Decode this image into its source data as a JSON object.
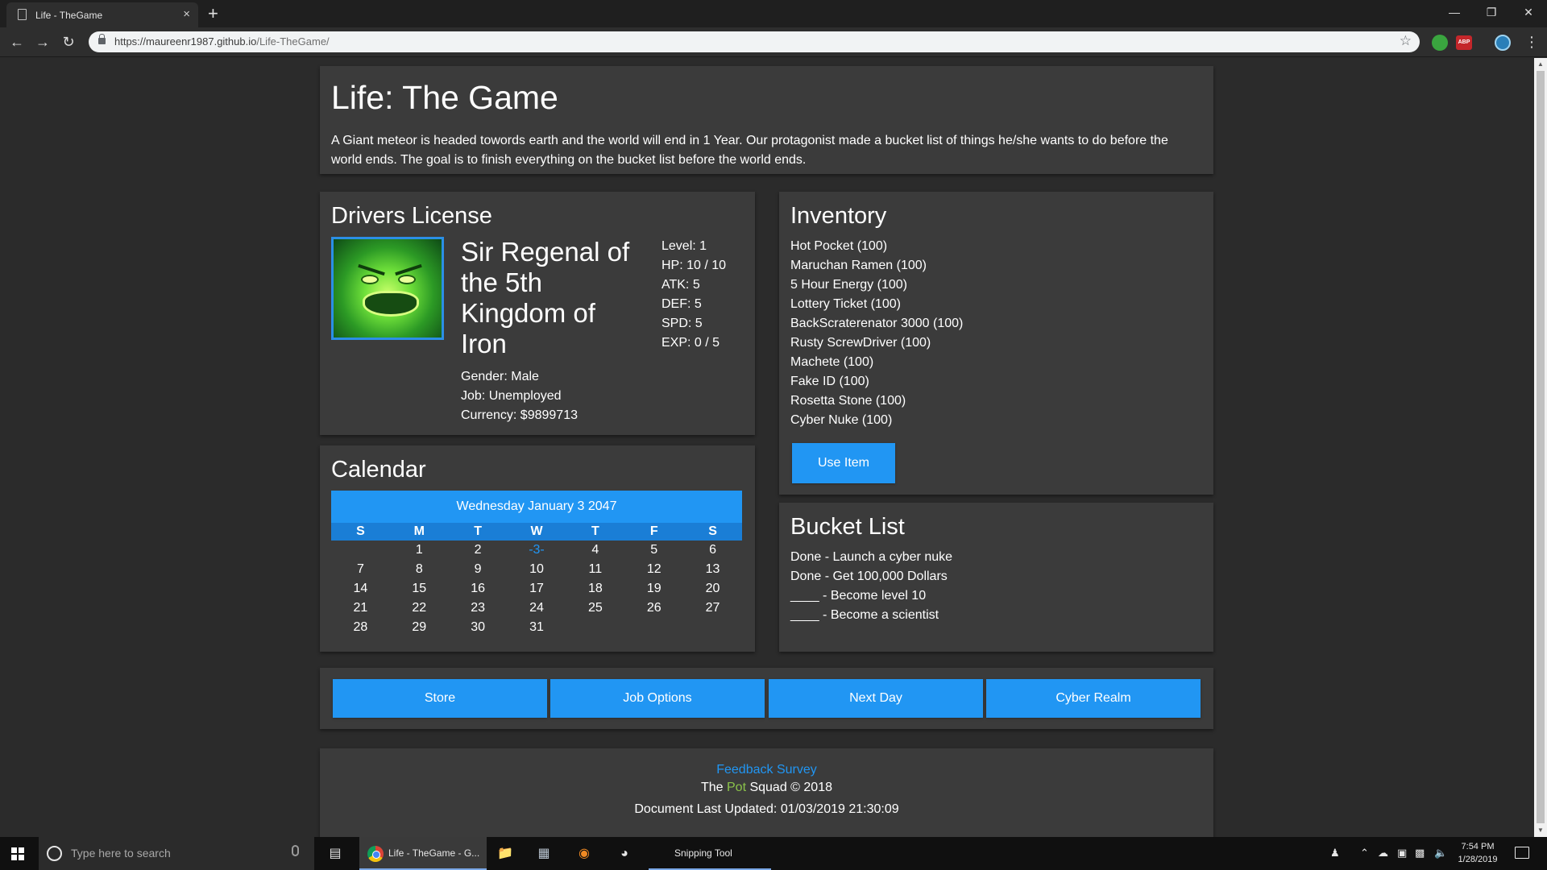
{
  "browser": {
    "tab_title": "Life - TheGame",
    "tab_close": "×",
    "new_tab": "+",
    "url_host": "https://maureenr1987.github.io",
    "url_path": "/Life-TheGame/",
    "abp_label": "ABP",
    "window_minimize": "—",
    "window_restore": "❐",
    "window_close": "✕"
  },
  "header": {
    "title": "Life: The Game",
    "description": "A Giant meteor is headed towords earth and the world will end in 1 Year. Our protagonist made a bucket list of things he/she wants to do before the world ends. The goal is to finish everything on the bucket list before the world ends."
  },
  "license": {
    "heading": "Drivers License",
    "name": "Sir Regenal of the 5th Kingdom of Iron",
    "gender": "Gender: Male",
    "job": "Job: Unemployed",
    "currency": "Currency: $9899713",
    "stats": {
      "level": "Level: 1",
      "hp": "HP: 10 / 10",
      "atk": "ATK: 5",
      "def": "DEF: 5",
      "spd": "SPD: 5",
      "exp": "EXP: 0 / 5"
    }
  },
  "calendar": {
    "heading": "Calendar",
    "date_header": "Wednesday January 3 2047",
    "weekdays": [
      "S",
      "M",
      "T",
      "W",
      "T",
      "F",
      "S"
    ],
    "weeks": [
      [
        "",
        "1",
        "2",
        "-3-",
        "4",
        "5",
        "6"
      ],
      [
        "7",
        "8",
        "9",
        "10",
        "11",
        "12",
        "13"
      ],
      [
        "14",
        "15",
        "16",
        "17",
        "18",
        "19",
        "20"
      ],
      [
        "21",
        "22",
        "23",
        "24",
        "25",
        "26",
        "27"
      ],
      [
        "28",
        "29",
        "30",
        "31",
        "",
        "",
        ""
      ]
    ]
  },
  "inventory": {
    "heading": "Inventory",
    "items": [
      "Hot Pocket (100)",
      "Maruchan Ramen (100)",
      "5 Hour Energy (100)",
      "Lottery Ticket (100)",
      "BackScraterenator 3000 (100)",
      "Rusty ScrewDriver (100)",
      "Machete (100)",
      "Fake ID (100)",
      "Rosetta Stone (100)",
      "Cyber Nuke (100)"
    ],
    "use_button": "Use Item"
  },
  "bucket_list": {
    "heading": "Bucket List",
    "items": [
      "Done - Launch a cyber nuke",
      "Done - Get 100,000 Dollars",
      "____ - Become level 10",
      "____ - Become a scientist"
    ]
  },
  "actions": {
    "store": "Store",
    "job_options": "Job Options",
    "next_day": "Next Day",
    "cyber_realm": "Cyber Realm"
  },
  "footer": {
    "survey": "Feedback Survey",
    "credits_pre": "The ",
    "credits_pot": "Pot",
    "credits_post": " Squad © 2018",
    "updated": "Document Last Updated: 01/03/2019 21:30:09"
  },
  "taskbar": {
    "search_placeholder": "Type here to search",
    "chrome_app": "Life - TheGame - G...",
    "snipping_app": "Snipping Tool",
    "time": "7:54 PM",
    "date": "1/28/2019"
  },
  "colors": {
    "accent": "#2196f3",
    "panel": "#3b3b3b",
    "background": "#2b2b2b",
    "pot_green": "#8bc34a"
  }
}
